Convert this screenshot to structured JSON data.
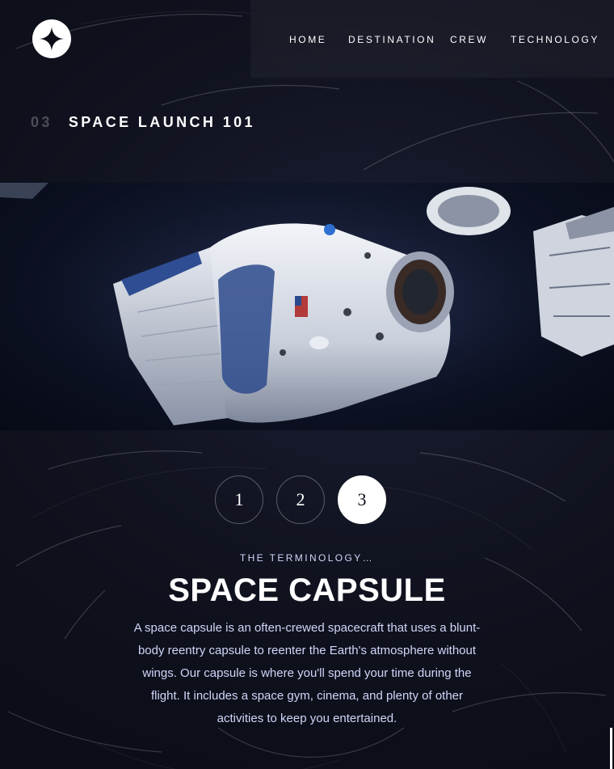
{
  "brand": {
    "logo_icon": "four-point-star-icon"
  },
  "nav": {
    "items": [
      {
        "label": "HOME"
      },
      {
        "label": "DESTINATION"
      },
      {
        "label": "CREW"
      },
      {
        "label": "TECHNOLOGY"
      }
    ]
  },
  "page": {
    "number": "03",
    "title": "SPACE LAUNCH 101"
  },
  "hero": {
    "image_icon": "space-capsule-icon"
  },
  "pager": {
    "buttons": [
      "1",
      "2",
      "3"
    ],
    "active": "3"
  },
  "content": {
    "eyebrow": "THE TERMINOLOGY…",
    "heading": "SPACE CAPSULE",
    "description": "A space capsule is an often-crewed spacecraft that uses a blunt-body reentry capsule to reenter the Earth's atmosphere without wings. Our capsule is where you'll spend your time during the flight. It includes a space gym, cinema, and plenty of other activities to keep you entertained."
  },
  "colors": {
    "background": "#0b0d17",
    "text": "#ffffff",
    "muted": "#d0d6f9",
    "accent": "#ffffff"
  }
}
